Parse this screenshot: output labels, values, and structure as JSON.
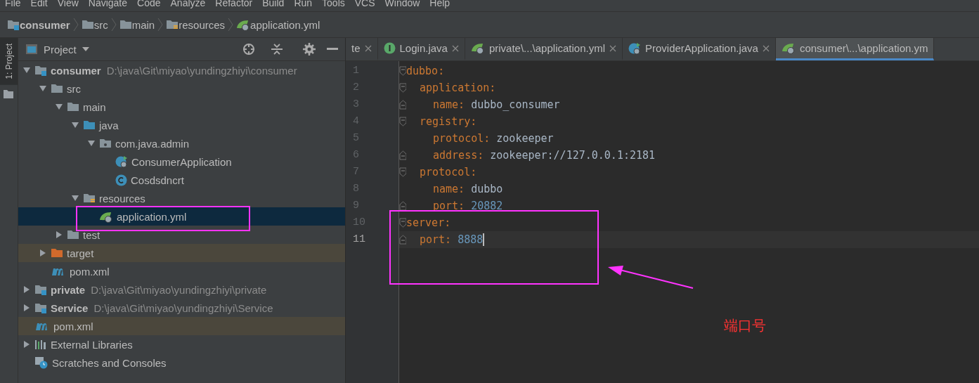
{
  "menu": [
    "File",
    "Edit",
    "View",
    "Navigate",
    "Code",
    "Analyze",
    "Refactor",
    "Build",
    "Run",
    "Tools",
    "VCS",
    "Window",
    "Help"
  ],
  "breadcrumb": [
    {
      "label": "consumer",
      "kind": "module"
    },
    {
      "label": "src",
      "kind": "folder"
    },
    {
      "label": "main",
      "kind": "folder"
    },
    {
      "label": "resources",
      "kind": "resources"
    },
    {
      "label": "application.yml",
      "kind": "spring"
    }
  ],
  "side_stripe": {
    "label": "1: Project"
  },
  "project_panel": {
    "title": "Project",
    "tree": [
      {
        "label": "consumer",
        "path": "D:\\java\\Git\\miyao\\yundingzhiyi\\consumer",
        "kind": "module",
        "expanded": true,
        "selected": false,
        "excluded": false,
        "children": [
          {
            "label": "src",
            "kind": "folder",
            "expanded": true,
            "selected": false,
            "excluded": false,
            "children": [
              {
                "label": "main",
                "kind": "folder",
                "expanded": true,
                "selected": false,
                "excluded": false,
                "children": [
                  {
                    "label": "java",
                    "kind": "source",
                    "expanded": true,
                    "selected": false,
                    "excluded": false,
                    "children": [
                      {
                        "label": "com.java.admin",
                        "kind": "package",
                        "expanded": true,
                        "selected": false,
                        "excluded": false,
                        "children": [
                          {
                            "label": "ConsumerApplication",
                            "kind": "runclass",
                            "selected": false,
                            "excluded": false
                          },
                          {
                            "label": "Cosdsdncrt",
                            "kind": "class",
                            "selected": false,
                            "excluded": false
                          }
                        ]
                      }
                    ]
                  },
                  {
                    "label": "resources",
                    "kind": "resources",
                    "expanded": true,
                    "selected": false,
                    "excluded": false,
                    "children": [
                      {
                        "label": "application.yml",
                        "kind": "spring",
                        "selected": true,
                        "excluded": false
                      }
                    ]
                  }
                ]
              },
              {
                "label": "test",
                "kind": "folder",
                "expanded": false,
                "selected": false,
                "excluded": false
              }
            ]
          },
          {
            "label": "target",
            "kind": "excluded",
            "expanded": false,
            "selected": false,
            "excluded": true
          },
          {
            "label": "pom.xml",
            "kind": "maven",
            "selected": false,
            "excluded": false
          }
        ]
      },
      {
        "label": "private",
        "path": "D:\\java\\Git\\miyao\\yundingzhiyi\\private",
        "kind": "module",
        "expanded": false,
        "selected": false,
        "excluded": false
      },
      {
        "label": "Service",
        "path": "D:\\java\\Git\\miyao\\yundingzhiyi\\Service",
        "kind": "module",
        "expanded": false,
        "selected": false,
        "excluded": false
      },
      {
        "label": "pom.xml",
        "kind": "maven",
        "selected": false,
        "excluded": true
      },
      {
        "label": "External Libraries",
        "kind": "libraries",
        "expanded": false,
        "selected": false,
        "excluded": false
      },
      {
        "label": "Scratches and Consoles",
        "kind": "scratches",
        "selected": false,
        "excluded": false
      }
    ]
  },
  "editor_tabs": [
    {
      "label": "te",
      "kind": "none",
      "selected": false
    },
    {
      "label": "Login.java",
      "kind": "interface",
      "selected": false
    },
    {
      "label": "private\\...\\application.yml",
      "kind": "spring",
      "selected": false
    },
    {
      "label": "ProviderApplication.java",
      "kind": "runclass",
      "selected": false
    },
    {
      "label": "consumer\\...\\application.ym",
      "kind": "spring",
      "selected": true
    }
  ],
  "code": [
    {
      "number": "1",
      "key": "dubbo:",
      "current": false,
      "children": [
        {
          "number": "2",
          "key": "application:",
          "current": false,
          "children": [
            {
              "number": "3",
              "key": "name:",
              "value": "dubbo_consumer",
              "kind": "string",
              "current": false
            }
          ]
        },
        {
          "number": "4",
          "key": "registry:",
          "current": false,
          "children": [
            {
              "number": "5",
              "key": "protocol:",
              "value": "zookeeper",
              "kind": "string",
              "current": false
            },
            {
              "number": "6",
              "key": "address:",
              "value": "zookeeper://127.0.0.1:2181",
              "kind": "string",
              "current": false
            }
          ]
        },
        {
          "number": "7",
          "key": "protocol:",
          "current": false,
          "children": [
            {
              "number": "8",
              "key": "name:",
              "value": "dubbo",
              "kind": "string",
              "current": false
            },
            {
              "number": "9",
              "key": "port:",
              "value": "20882",
              "kind": "number",
              "current": false
            }
          ]
        }
      ]
    },
    {
      "number": "10",
      "key": "server:",
      "current": false,
      "children": [
        {
          "number": "11",
          "key": "port:",
          "value": "8888",
          "kind": "number",
          "current": true
        }
      ]
    }
  ],
  "annotation": {
    "label": "端口号"
  }
}
